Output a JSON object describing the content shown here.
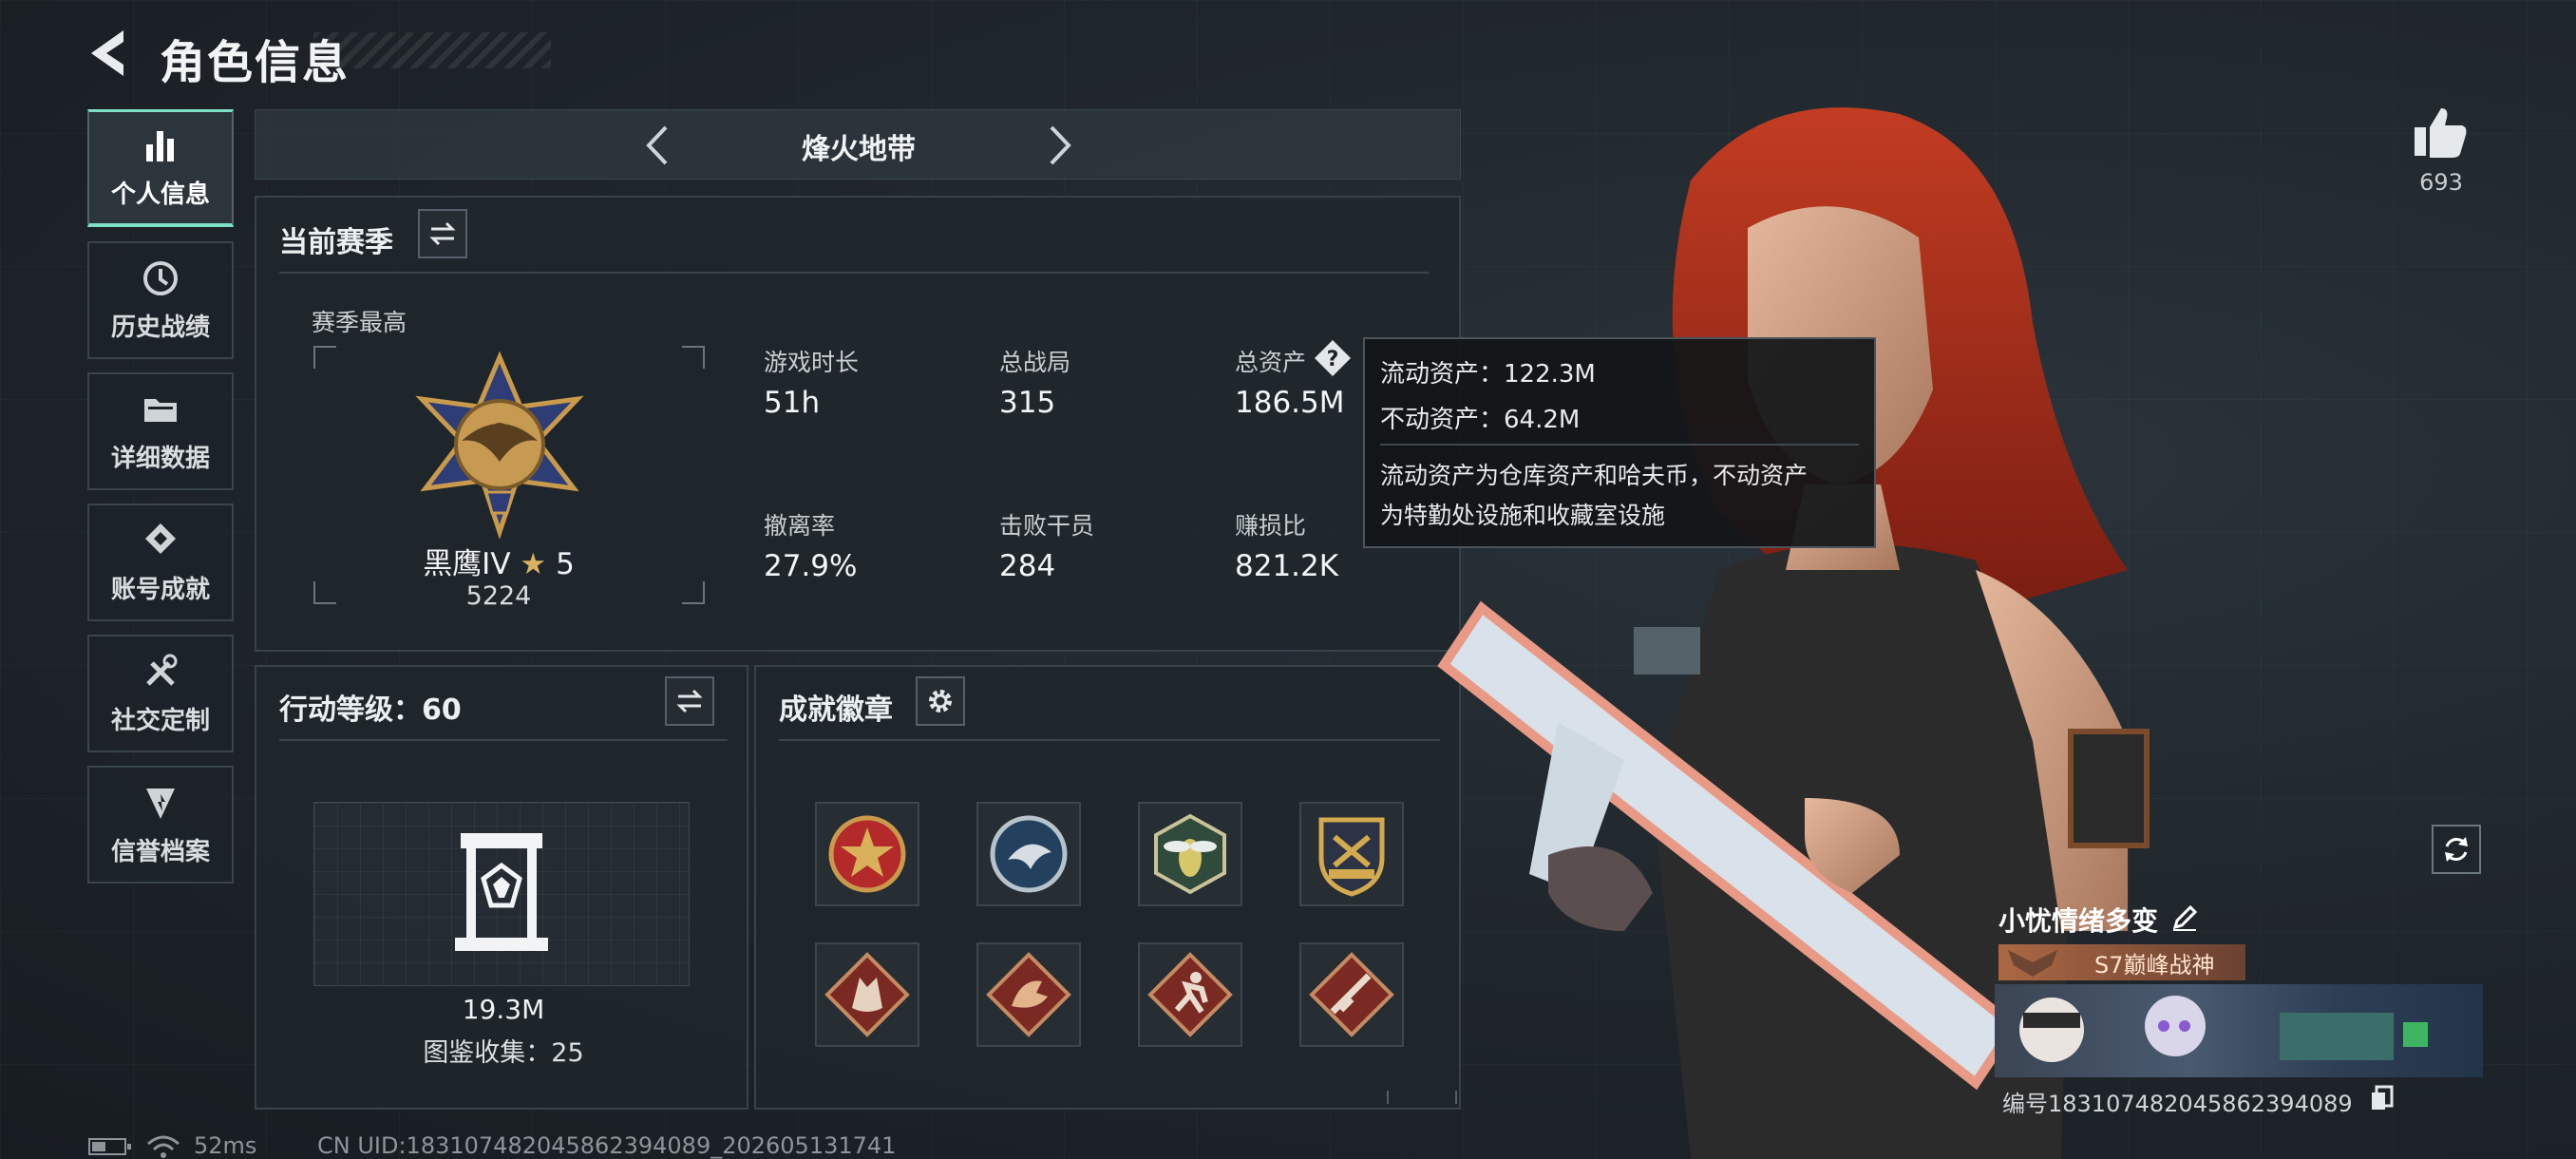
{
  "header": {
    "title": "角色信息"
  },
  "sidebar": {
    "items": [
      {
        "label": "个人信息",
        "icon": "bar-chart-icon",
        "active": true
      },
      {
        "label": "历史战绩",
        "icon": "history-clock-icon"
      },
      {
        "label": "详细数据",
        "icon": "folder-icon"
      },
      {
        "label": "账号成就",
        "icon": "achievement-icon"
      },
      {
        "label": "社交定制",
        "icon": "tools-icon"
      },
      {
        "label": "信誉档案",
        "icon": "shield-icon"
      }
    ]
  },
  "mode": {
    "title": "烽火地带"
  },
  "season": {
    "title": "当前赛季",
    "best_label": "赛季最高",
    "rank_name": "黑鹰IV",
    "rank_stars": "5",
    "rank_score": "5224",
    "stats": [
      {
        "label": "游戏时长",
        "value": "51h"
      },
      {
        "label": "总战局",
        "value": "315"
      },
      {
        "label": "总资产",
        "value": "186.5M"
      },
      {
        "label": "撤离率",
        "value": "27.9%"
      },
      {
        "label": "击败干员",
        "value": "284"
      },
      {
        "label": "赚损比",
        "value": "821.2K"
      }
    ]
  },
  "tooltip": {
    "line1": "流动资产：122.3M",
    "line2": "不动资产：64.2M",
    "desc1": "流动资产为仓库资产和哈夫币，不动资产",
    "desc2": "为特勤处设施和收藏室设施"
  },
  "action_level": {
    "title": "行动等级：60",
    "value": "19.3M",
    "collection": "图鉴收集：25"
  },
  "achievements": {
    "title": "成就徽章",
    "badges": [
      "star-badge-icon",
      "eagle-badge-icon",
      "wasp-badge-icon",
      "crest-badge-icon",
      "wolf-badge-icon",
      "dragon-badge-icon",
      "runner-badge-icon",
      "rifle-badge-icon"
    ]
  },
  "player": {
    "likes": "693",
    "name": "小忧情绪多变",
    "season_rank": "S7巅峰战神",
    "id_text": "编号18310748204586239408​9"
  },
  "footer": {
    "ping": "52ms",
    "uid": "CN UID:18310748204586239408​9_202605131741"
  },
  "colors": {
    "accent": "#7be0c4",
    "panel_border": "#38424a",
    "hair": "#b8321e"
  }
}
